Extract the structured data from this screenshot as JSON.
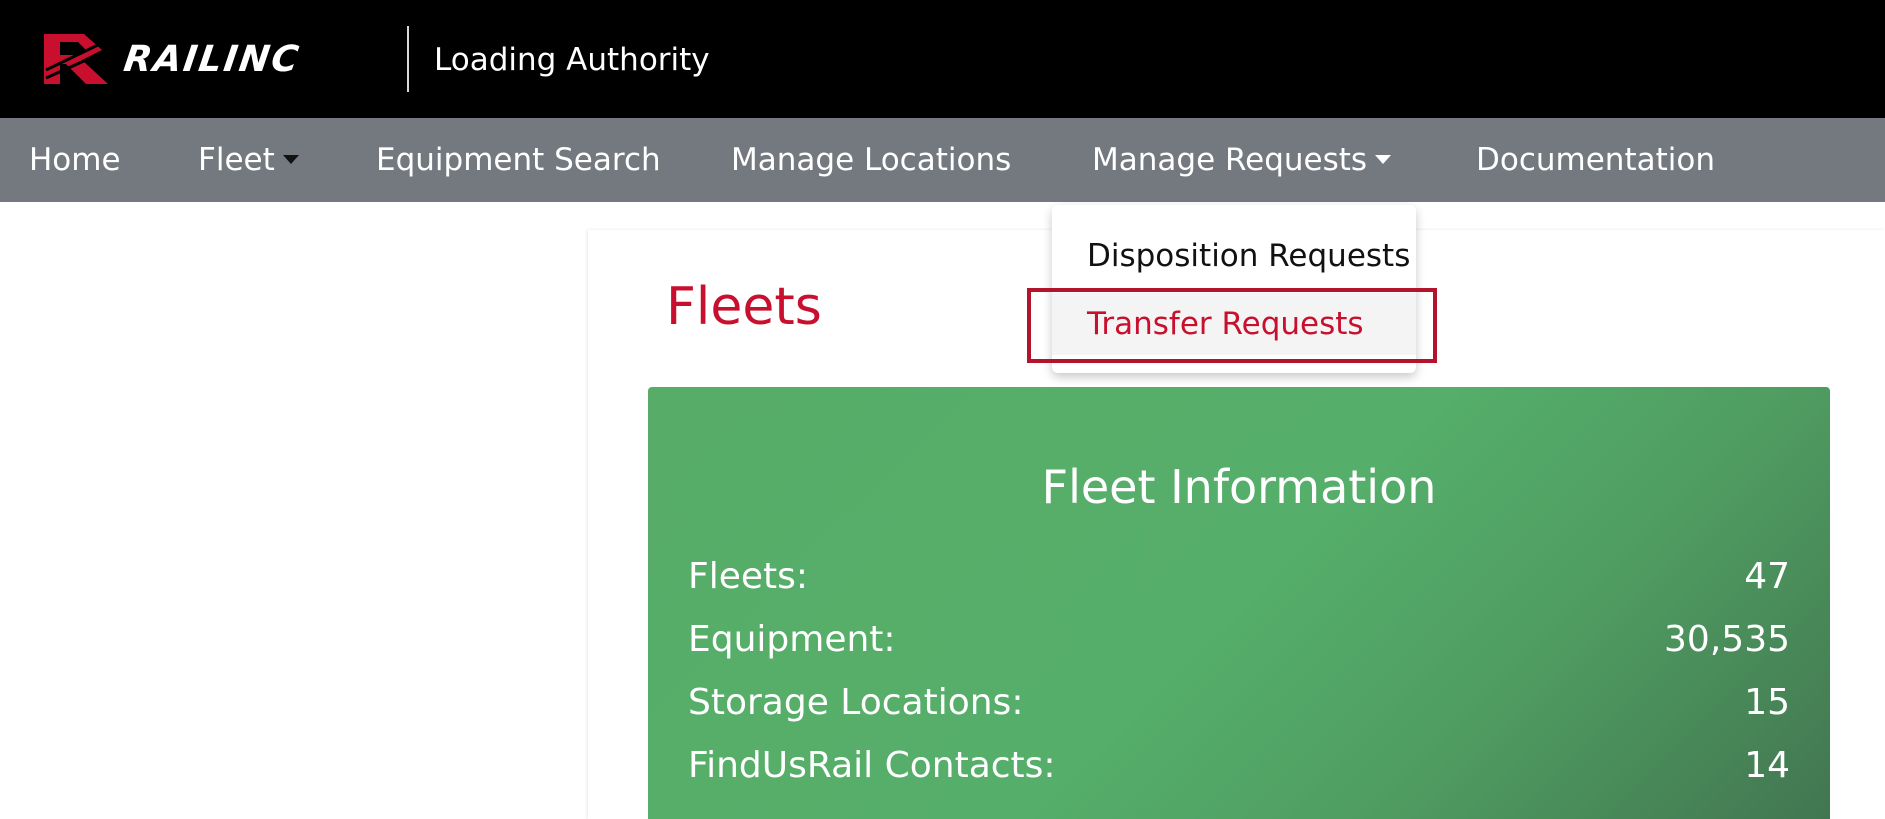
{
  "header": {
    "brand": "RAILINC",
    "app_title": "Loading Authority",
    "logo_icon": "railinc-logo-icon",
    "brand_color": "#c8102e"
  },
  "nav": {
    "home": "Home",
    "fleet": "Fleet",
    "equipment_search": "Equipment Search",
    "manage_locations": "Manage Locations",
    "manage_requests": "Manage Requests",
    "documentation": "Documentation"
  },
  "dropdown": {
    "items": [
      {
        "label": "Disposition Requests",
        "state": "normal"
      },
      {
        "label": "Transfer Requests",
        "state": "highlighted"
      }
    ]
  },
  "main": {
    "page_title": "Fleets",
    "card": {
      "title": "Fleet Information",
      "color": "#55ae6a",
      "stats": [
        {
          "label": "Fleets:",
          "value": "47"
        },
        {
          "label": "Equipment:",
          "value": "30,535"
        },
        {
          "label": "Storage Locations:",
          "value": "15"
        },
        {
          "label": "FindUsRail Contacts:",
          "value": "14"
        }
      ]
    }
  }
}
